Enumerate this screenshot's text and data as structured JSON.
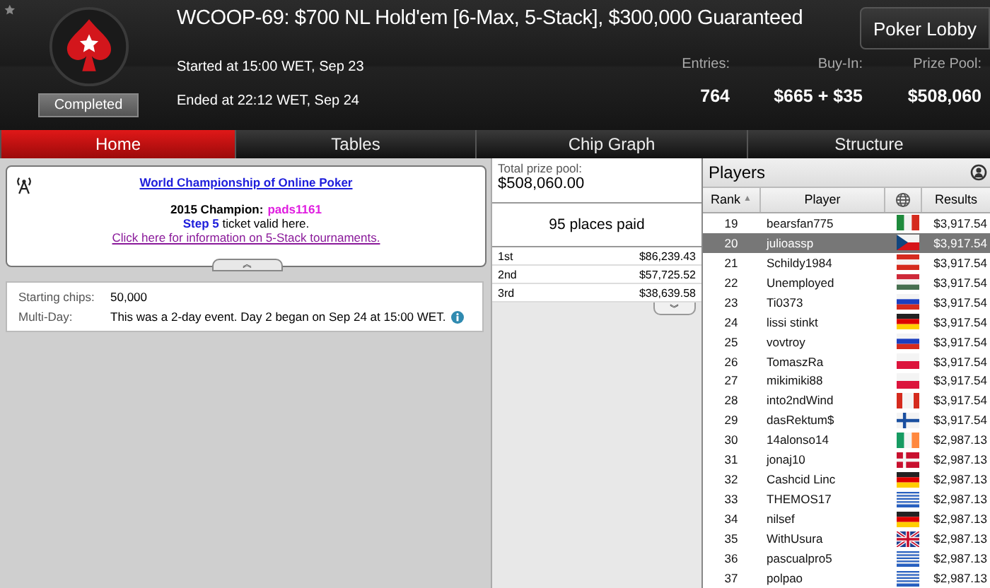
{
  "header": {
    "title": "WCOOP-69: $700 NL Hold'em [6-Max, 5-Stack], $300,000 Guaranteed",
    "status": "Completed",
    "started": "Started at 15:00 WET, Sep 23",
    "ended": "Ended at 22:12 WET, Sep 24",
    "lobby_button": "Poker Lobby",
    "stats": [
      {
        "label": "Entries:",
        "value": "764"
      },
      {
        "label": "Buy-In:",
        "value": "$665 + $35"
      },
      {
        "label": "Prize Pool:",
        "value": "$508,060"
      }
    ]
  },
  "tabs": [
    {
      "label": "Home",
      "selected": true
    },
    {
      "label": "Tables",
      "selected": false
    },
    {
      "label": "Chip Graph",
      "selected": false
    },
    {
      "label": "Structure",
      "selected": false
    }
  ],
  "info": {
    "link": "World Championship of Online Poker",
    "champion_label": "2015 Champion:",
    "champion": "pads1161",
    "ticket": "**Step 5** ticket valid here.",
    "info_link": "Click here for information on 5-Stack tournaments.",
    "collapse": "︽"
  },
  "details": [
    {
      "label": "Starting chips:",
      "value": "50,000",
      "info": false
    },
    {
      "label": "Multi-Day:",
      "value": "This was a 2-day event. Day 2 began on Sep 24 at 15:00 WET.",
      "info": true
    }
  ],
  "prizes": {
    "label": "Total prize pool:",
    "total": "$508,060.00",
    "places": "95 places paid",
    "expand": "︾",
    "rows": [
      {
        "place": "1st",
        "amount": "$86,239.43"
      },
      {
        "place": "2nd",
        "amount": "$57,725.52"
      },
      {
        "place": "3rd",
        "amount": "$38,639.58"
      }
    ]
  },
  "players": {
    "title": "Players",
    "columns": [
      "Rank",
      "Player",
      "Results"
    ],
    "sort_mark": "▲",
    "rows": [
      {
        "rank": "19",
        "player": "bearsfan775",
        "kind": "mexico",
        "result": "$3,917.54",
        "selected": false
      },
      {
        "rank": "20",
        "player": "julioassp",
        "kind": "czech",
        "result": "$3,917.54",
        "selected": true
      },
      {
        "rank": "21",
        "player": "Schildy1984",
        "kind": "austria",
        "result": "$3,917.54",
        "selected": false
      },
      {
        "rank": "22",
        "player": "Unemployed",
        "kind": "hungary",
        "result": "$3,917.54",
        "selected": false
      },
      {
        "rank": "23",
        "player": "Ti0373",
        "kind": "russia",
        "result": "$3,917.54",
        "selected": false
      },
      {
        "rank": "24",
        "player": "lissi stinkt",
        "kind": "germany",
        "result": "$3,917.54",
        "selected": false
      },
      {
        "rank": "25",
        "player": "vovtroy",
        "kind": "russia",
        "result": "$3,917.54",
        "selected": false
      },
      {
        "rank": "26",
        "player": "TomaszRa",
        "kind": "poland",
        "result": "$3,917.54",
        "selected": false
      },
      {
        "rank": "27",
        "player": "mikimiki88",
        "kind": "poland",
        "result": "$3,917.54",
        "selected": false
      },
      {
        "rank": "28",
        "player": "into2ndWind",
        "kind": "canada",
        "result": "$3,917.54",
        "selected": false
      },
      {
        "rank": "29",
        "player": "dasRektum$",
        "kind": "finland",
        "result": "$3,917.54",
        "selected": false
      },
      {
        "rank": "30",
        "player": "14alonso14",
        "kind": "ireland",
        "result": "$2,987.13",
        "selected": false
      },
      {
        "rank": "31",
        "player": "jonaj10",
        "kind": "denmark",
        "result": "$2,987.13",
        "selected": false
      },
      {
        "rank": "32",
        "player": "Cashcid Linc",
        "kind": "germany",
        "result": "$2,987.13",
        "selected": false
      },
      {
        "rank": "33",
        "player": "THEMOS17",
        "kind": "greece",
        "result": "$2,987.13",
        "selected": false
      },
      {
        "rank": "34",
        "player": "nilsef",
        "kind": "germany",
        "result": "$2,987.13",
        "selected": false
      },
      {
        "rank": "35",
        "player": "WithUsura",
        "kind": "uk",
        "result": "$2,987.13",
        "selected": false
      },
      {
        "rank": "36",
        "player": "pascualpro5",
        "kind": "greece",
        "result": "$2,987.13",
        "selected": false
      },
      {
        "rank": "37",
        "player": "polpao",
        "kind": "greece",
        "result": "$2,987.13",
        "selected": false
      }
    ]
  }
}
